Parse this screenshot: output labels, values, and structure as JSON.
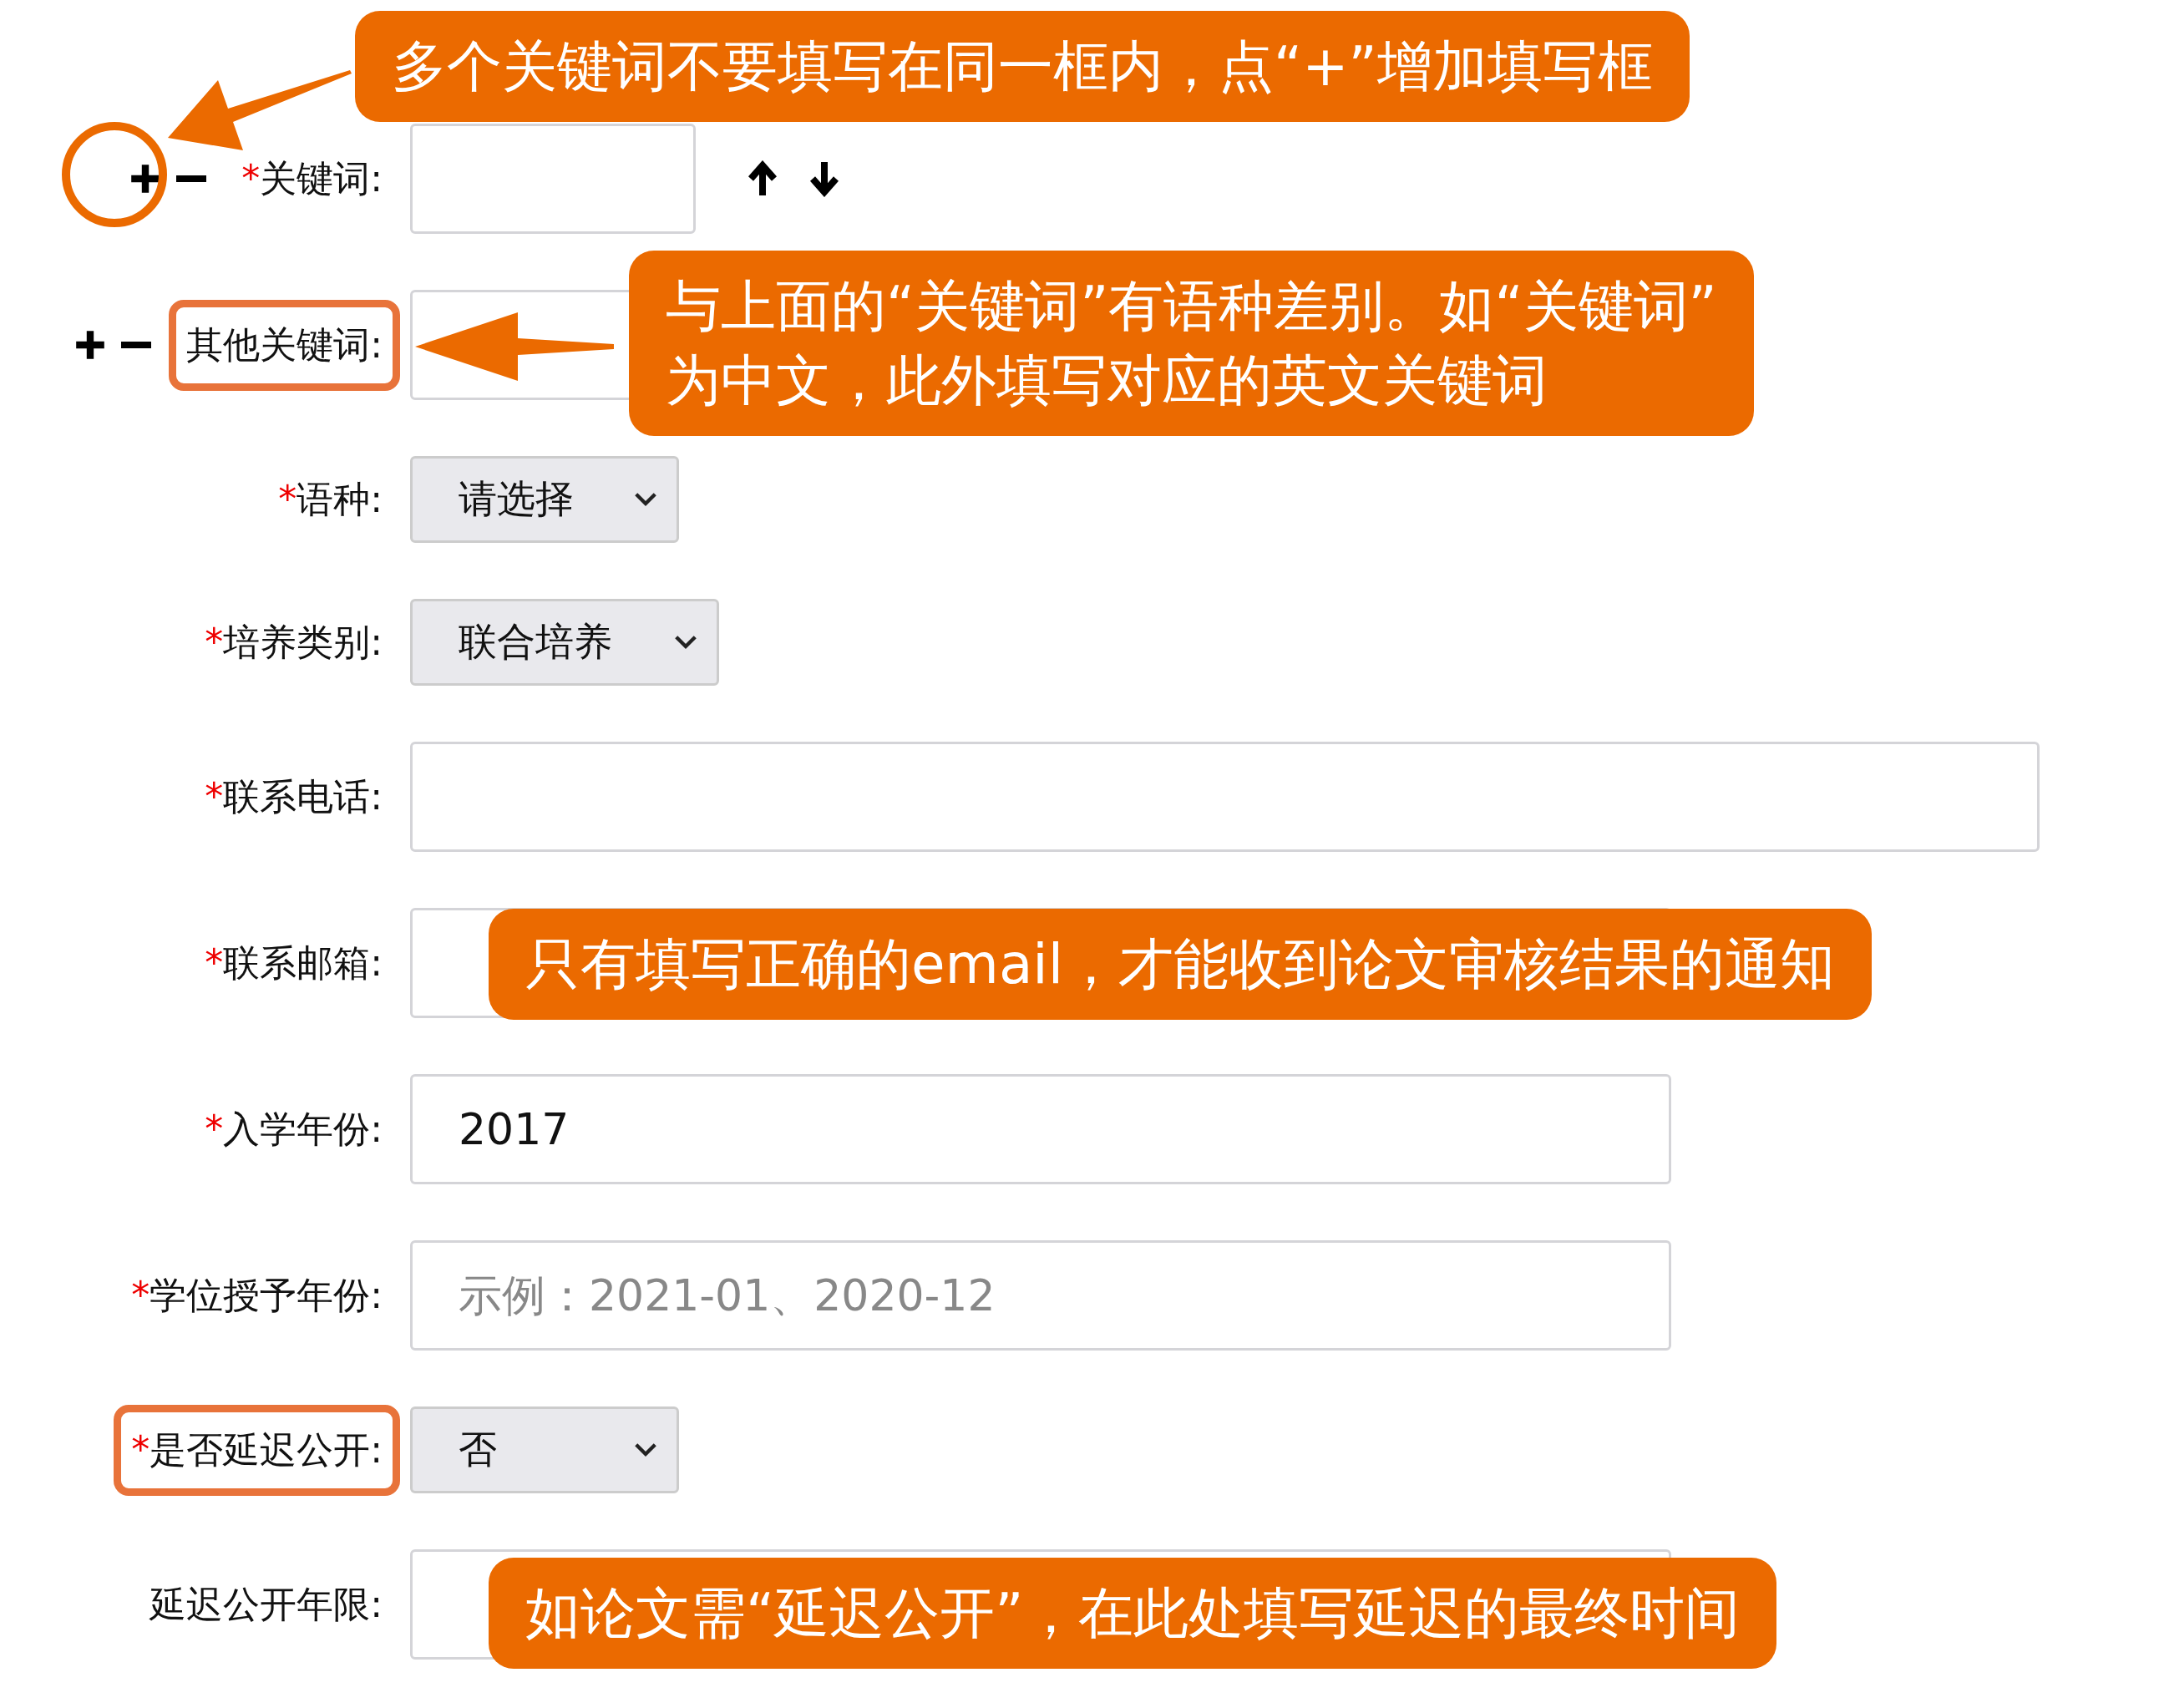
{
  "form": {
    "rows": [
      {
        "kind": "keyword",
        "label": "关键词:",
        "required_mark": "*",
        "value": "",
        "plus_circled": true,
        "has_reorder": true,
        "highlighted": false
      },
      {
        "kind": "keyword",
        "label": "其他关键词:",
        "value": "",
        "plus_circled": false,
        "has_reorder": false,
        "highlighted": true
      },
      {
        "kind": "select",
        "label": "语种:",
        "required_mark": "*",
        "value": "请选择",
        "highlighted": false
      },
      {
        "kind": "select",
        "label": "培养类别:",
        "required_mark": "*",
        "value": "联合培养",
        "highlighted": false
      },
      {
        "kind": "text",
        "label": "联系电话:",
        "required_mark": "*",
        "value": "",
        "highlighted": false
      },
      {
        "kind": "text",
        "label": "联系邮箱:",
        "required_mark": "*",
        "value": "",
        "highlighted": false
      },
      {
        "kind": "text",
        "label": "入学年份:",
        "required_mark": "*",
        "value": "2017",
        "highlighted": false
      },
      {
        "kind": "text",
        "label": "学位授予年份:",
        "required_mark": "*",
        "value": "",
        "placeholder": "示例：2021-01、2020-12",
        "highlighted": false
      },
      {
        "kind": "select",
        "label": "是否延迟公开:",
        "required_mark": "*",
        "value": "否",
        "highlighted": true
      },
      {
        "kind": "text",
        "label": "延迟公开年限:",
        "value": "",
        "highlighted": false
      }
    ]
  },
  "callouts": [
    {
      "text": "多个关键词不要填写在同一框内，点“+”增加填写框"
    },
    {
      "text": "与上面的“关键词”有语种差别。如“关键词”\n为中文，此外填写对应的英文关键词"
    },
    {
      "text": "只有填写正确的email，才能收到论文审核结果的通知"
    },
    {
      "text": "如论文需“延迟公开”，在此处填写延迟的最终时间"
    }
  ]
}
